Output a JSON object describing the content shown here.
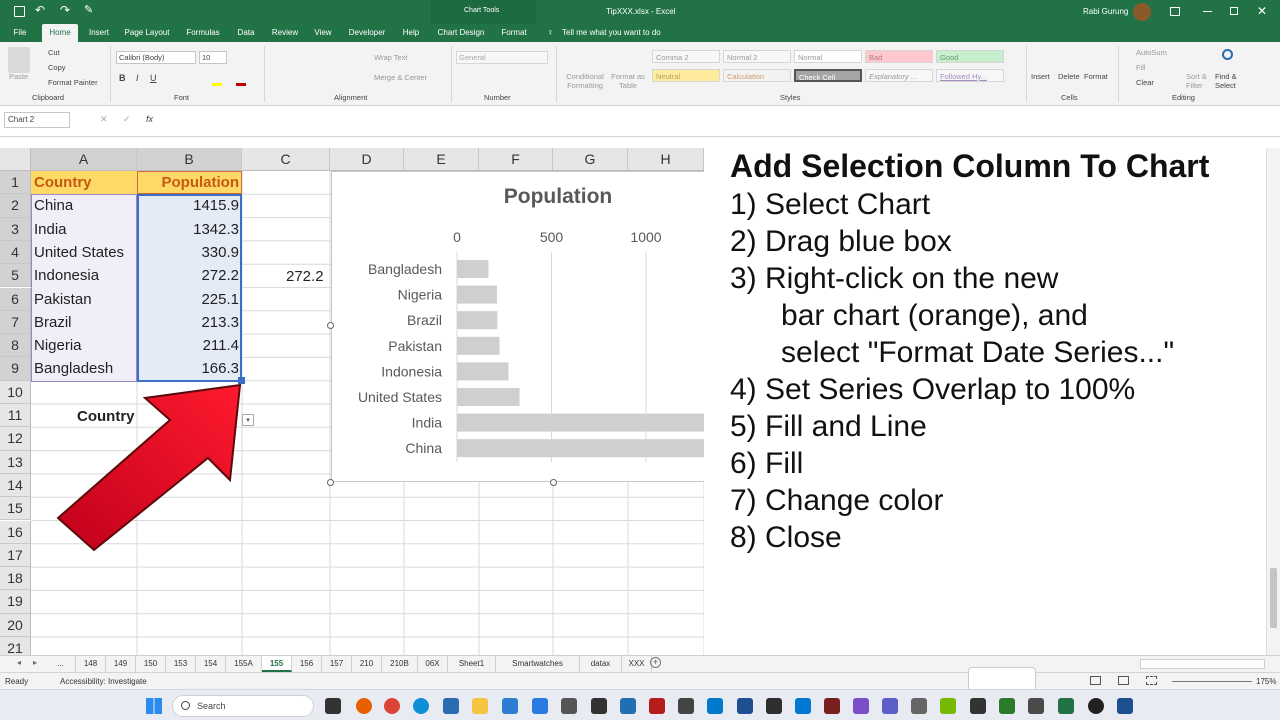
{
  "window": {
    "title": "TipXXX.xlsx  -  Excel",
    "user": "Rabi Gurung",
    "chart_tools": "Chart Tools"
  },
  "tabs": [
    "File",
    "Home",
    "Insert",
    "Page Layout",
    "Formulas",
    "Data",
    "Review",
    "View",
    "Developer",
    "Help",
    "Chart Design",
    "Format"
  ],
  "tell_me": "Tell me what you want to do",
  "ribbon": {
    "clipboard": {
      "paste": "Paste",
      "cut": "Cut",
      "copy": "Copy",
      "format_painter": "Format Painter",
      "label": "Clipboard"
    },
    "font": {
      "name": "Calibri (Body)",
      "size": "10",
      "label": "Font"
    },
    "alignment": {
      "wrap": "Wrap Text",
      "merge": "Merge & Center",
      "label": "Alignment"
    },
    "number": {
      "format": "General",
      "label": "Number"
    },
    "styles": {
      "cond": "Conditional Formatting",
      "table": "Format as Table",
      "items": [
        "Comma 2",
        "Normal 2",
        "Normal",
        "Bad",
        "Good",
        "Neutral",
        "Calculation",
        "Check Cell",
        "Explanatory ...",
        "Followed Hy..."
      ],
      "label": "Styles"
    },
    "cells": {
      "insert": "Insert",
      "delete": "Delete",
      "format": "Format",
      "label": "Cells"
    },
    "editing": {
      "autosum": "AutoSum",
      "fill": "Fill",
      "clear": "Clear",
      "sort": "Sort & Filter",
      "find": "Find & Select",
      "label": "Editing"
    }
  },
  "formula_bar": {
    "name_box": "Chart 2",
    "fx": "fx"
  },
  "columns": [
    "A",
    "B",
    "C",
    "D",
    "E",
    "F",
    "G",
    "H"
  ],
  "rows": [
    "1",
    "2",
    "3",
    "4",
    "5",
    "6",
    "7",
    "8",
    "9",
    "10",
    "11",
    "12",
    "13",
    "14",
    "15",
    "16",
    "17",
    "18",
    "19",
    "20",
    "21"
  ],
  "table": {
    "headers": [
      "Country",
      "Population"
    ],
    "rows": [
      [
        "China",
        "1415.9"
      ],
      [
        "India",
        "1342.3"
      ],
      [
        "United States",
        "330.9"
      ],
      [
        "Indonesia",
        "272.2"
      ],
      [
        "Pakistan",
        "225.1"
      ],
      [
        "Brazil",
        "213.3"
      ],
      [
        "Nigeria",
        "211.4"
      ],
      [
        "Bangladesh",
        "166.3"
      ]
    ]
  },
  "c5": "272.2",
  "a11": "Country",
  "chart_data": {
    "type": "bar",
    "title": "Population",
    "categories": [
      "Bangladesh",
      "Nigeria",
      "Brazil",
      "Pakistan",
      "Indonesia",
      "United States",
      "India",
      "China"
    ],
    "values": [
      166.3,
      211.4,
      213.3,
      225.1,
      272.2,
      330.9,
      1342.3,
      1415.9
    ],
    "xticks": [
      "0",
      "500",
      "1000"
    ],
    "xlim": [
      0,
      1500
    ],
    "bar_color": "#d0cece",
    "grid": true
  },
  "instructions": {
    "title": "Add Selection Column To Chart",
    "steps": [
      "1) Select Chart",
      "2) Drag blue box",
      "3) Right-click on the new",
      "   bar chart (orange), and",
      "   select \"Format Date Series...\"",
      "4) Set Series Overlap to 100%",
      "5) Fill and Line",
      "6) Fill",
      "7) Change color",
      "8) Close"
    ]
  },
  "sheets": [
    "...",
    "148",
    "149",
    "150",
    "153",
    "154",
    "155A",
    "155",
    "156",
    "157",
    "210",
    "210B",
    "06X",
    "Sheet1",
    "Smartwatches",
    "datax",
    "XXX"
  ],
  "active_sheet": "155",
  "status": {
    "ready": "Ready",
    "accessibility": "Accessibility: Investigate",
    "zoom": "175%"
  },
  "taskbar": {
    "search": "Search"
  }
}
